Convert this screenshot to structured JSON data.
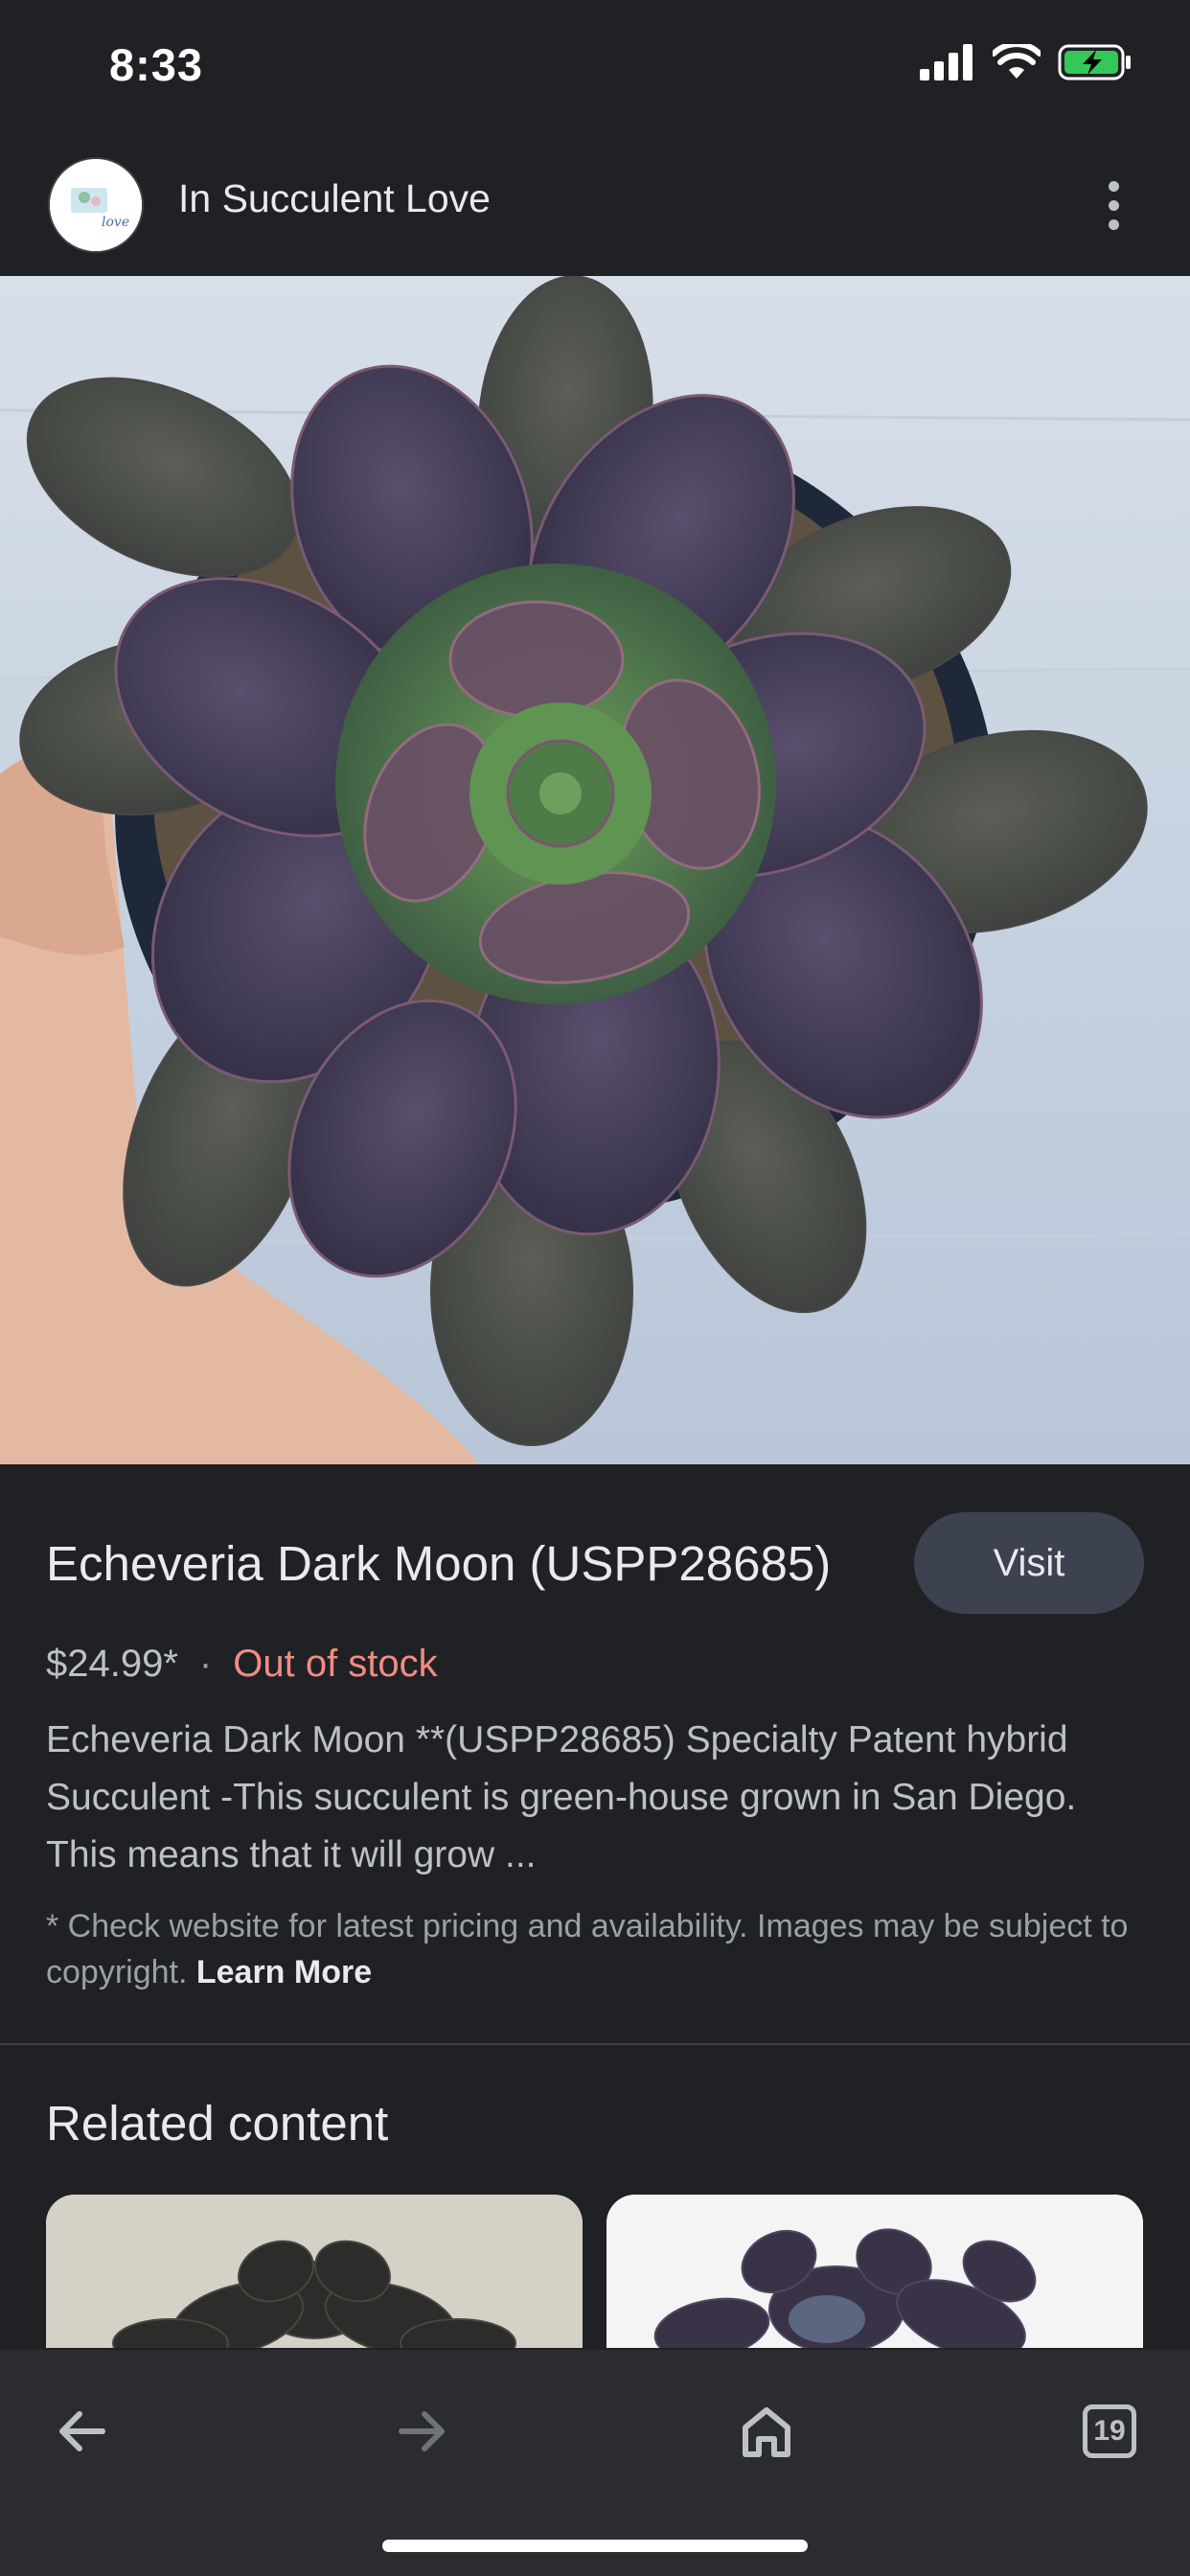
{
  "status_bar": {
    "time": "8:33"
  },
  "header": {
    "site_name": "In Succulent Love",
    "logo_text": "love"
  },
  "product": {
    "title": "Echeveria Dark Moon (USPP28685)",
    "visit_label": "Visit",
    "price": "$24.99*",
    "separator": "·",
    "stock_status": "Out of stock",
    "description": "Echeveria Dark Moon **(USPP28685) Specialty Patent hybrid Succulent -This succulent is green-house grown in San Diego. This means that it will grow ...",
    "disclaimer": "* Check website for latest pricing and availability. Images may be subject to copyright.",
    "learn_more": "Learn More"
  },
  "related": {
    "title": "Related content"
  },
  "toolbar": {
    "tab_count": "19"
  },
  "colors": {
    "background": "#202124",
    "stock_status": "#f28b82",
    "visit_button": "#3c4250"
  }
}
